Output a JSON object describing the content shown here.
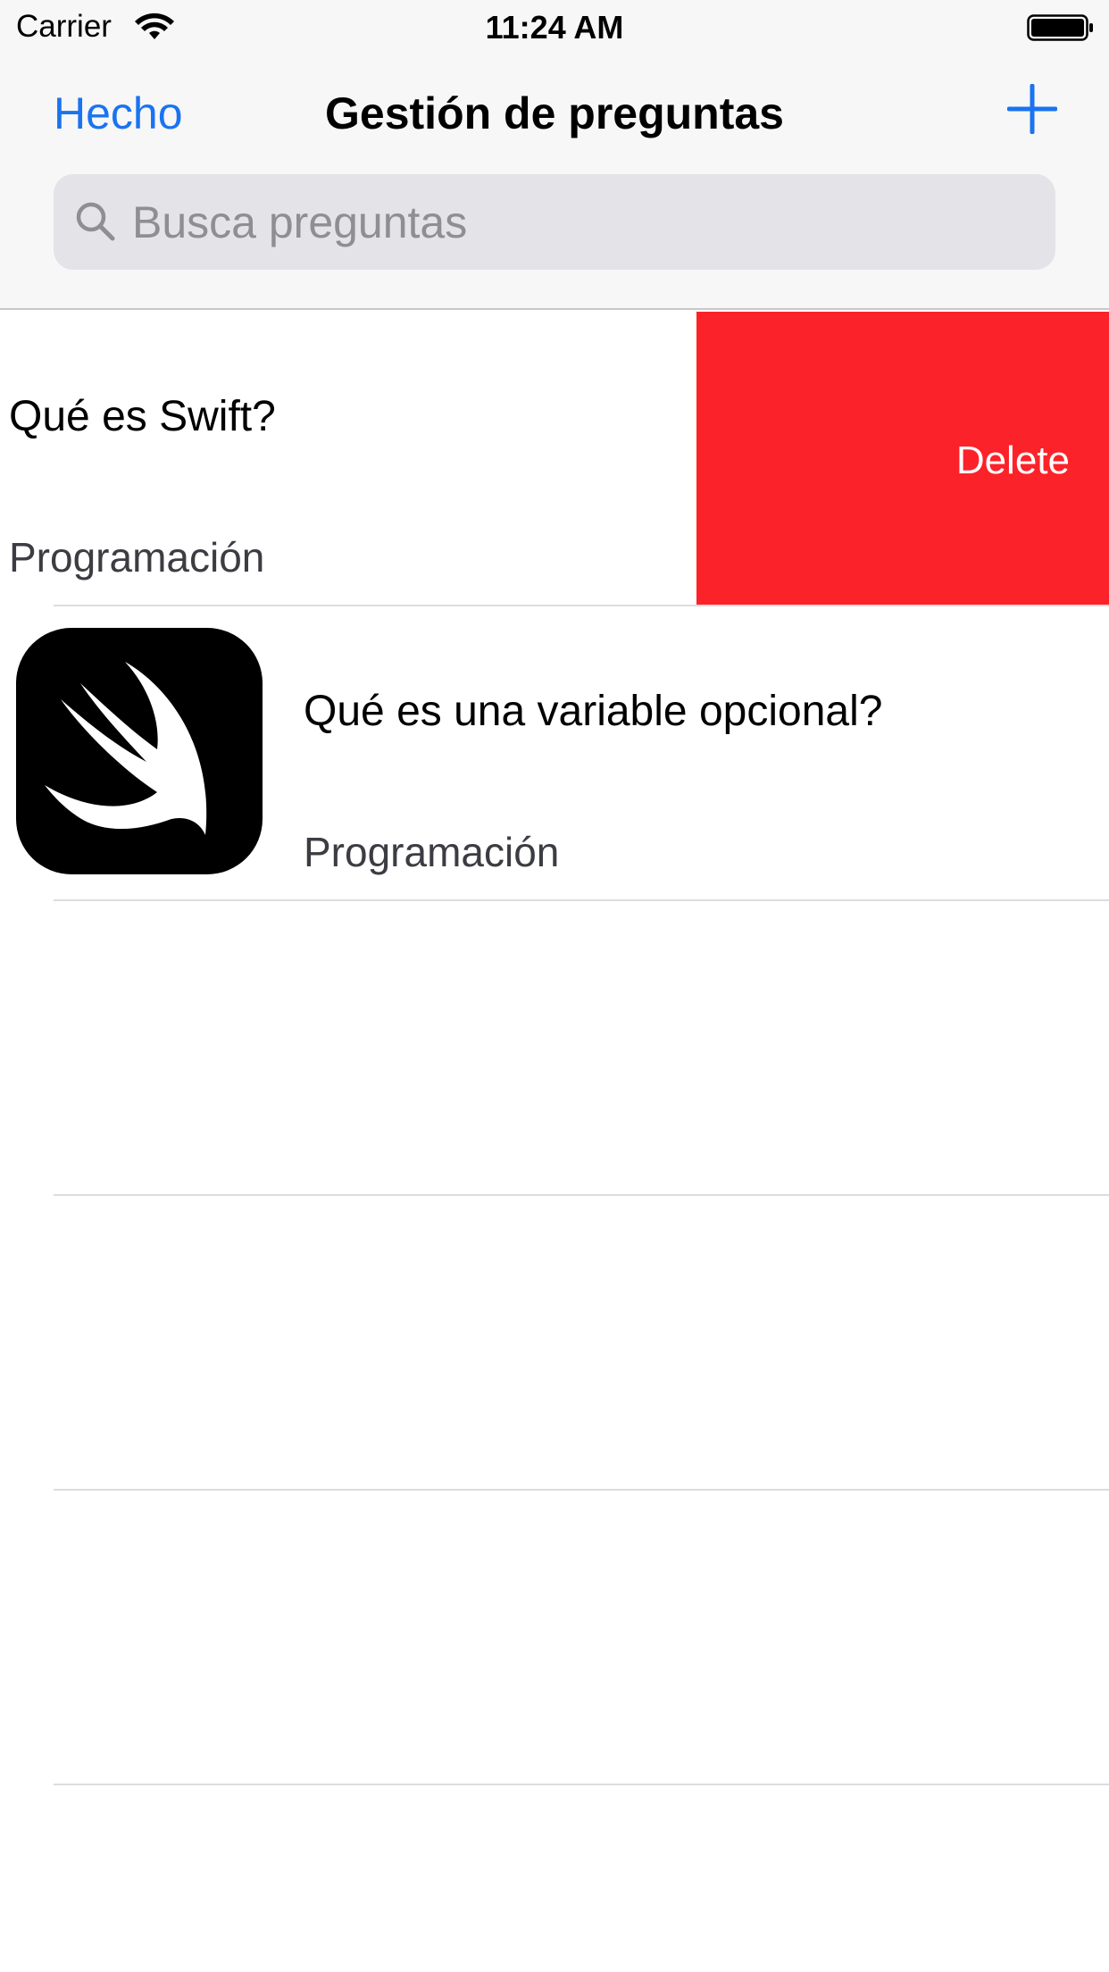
{
  "status_bar": {
    "carrier": "Carrier",
    "time": "11:24 AM"
  },
  "nav": {
    "done_label": "Hecho",
    "title": "Gestión de preguntas",
    "add_icon": "plus-icon"
  },
  "search": {
    "placeholder": "Busca preguntas",
    "icon": "search-icon"
  },
  "questions": [
    {
      "title": "Qué es Swift?",
      "category": "Programación",
      "icon": "swift-logo-icon",
      "swiped_action": "Delete"
    },
    {
      "title": "Qué es una variable opcional?",
      "category": "Programación",
      "icon": "swift-logo-icon"
    }
  ],
  "colors": {
    "accent": "#1a73f0",
    "delete": "#fc2229",
    "nav_background": "#f7f7f7",
    "search_field": "#e3e3e8",
    "separator": "#dcdce0"
  }
}
